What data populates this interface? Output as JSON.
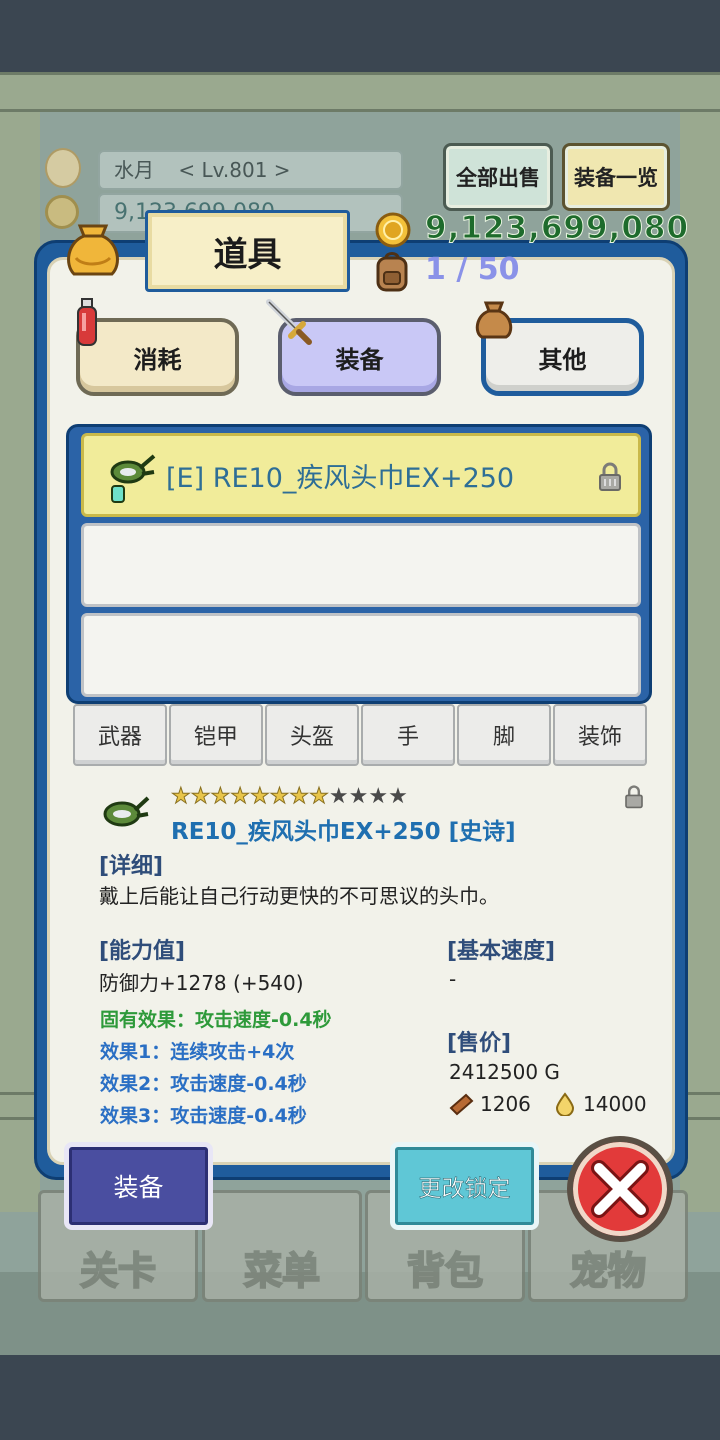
{
  "hud": {
    "player_name": "水月",
    "level": "< Lv.801 >",
    "gold_partial": "9,123,699,080"
  },
  "toolbar": {
    "sell_all": "全部出售",
    "equip_list": "装备一览"
  },
  "dialog": {
    "title": "道具",
    "gold": "9,123,699,080",
    "capacity": "1 / 50"
  },
  "categories": {
    "consume": "消耗",
    "equip": "装备",
    "other": "其他"
  },
  "items": [
    {
      "name": "[E] RE10_疾风头巾EX+250",
      "locked": true
    }
  ],
  "filters": [
    "武器",
    "铠甲",
    "头盔",
    "手",
    "脚",
    "装饰"
  ],
  "detail": {
    "stars_filled": 8,
    "stars_total": 12,
    "name": "RE10_疾风头巾EX+250 [史诗]",
    "detail_label": "[详细]",
    "description": "戴上后能让自己行动更快的不可思议的头巾。",
    "stats_label": "[能力值]",
    "stat": "防御力+1278 (+540)",
    "inherent": "固有效果：攻击速度-0.4秒",
    "effect1": "效果1：连续攻击+4次",
    "effect2": "效果2：攻击速度-0.4秒",
    "effect3": "效果3：攻击速度-0.4秒",
    "speed_label": "[基本速度]",
    "speed_value": "-",
    "price_label": "[售价]",
    "price": "2412500 G",
    "material1": "1206",
    "material2": "14000",
    "colors": {
      "inherent": "#2e9a3a",
      "effect": "#2a6fc4"
    }
  },
  "actions": {
    "equip": "装备",
    "change_lock": "更改锁定"
  },
  "nav": [
    "关卡",
    "菜单",
    "背包",
    "宠物"
  ]
}
